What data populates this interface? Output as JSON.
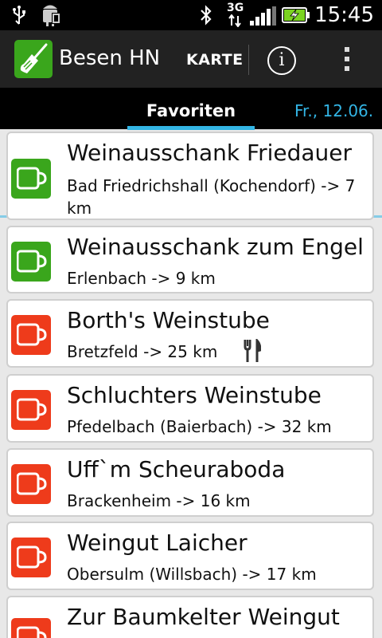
{
  "status_bar": {
    "time": "15:45",
    "network": "3G",
    "icons": [
      "usb-icon",
      "android-debug-icon",
      "bluetooth-icon",
      "signal-icon",
      "battery-charging-icon"
    ]
  },
  "action_bar": {
    "title": "Besen HN",
    "map_label": "KARTE",
    "info_glyph": "i"
  },
  "tabs": {
    "active": "Favoriten",
    "next": "Fr., 12.06."
  },
  "colors": {
    "open": "#3aa61c",
    "closed": "#ee3b1b",
    "accent": "#33b5e5"
  },
  "items": [
    {
      "title": "Weinausschank Friedauer",
      "subtitle": "Bad Friedrichshall (Kochendorf) -> 7 km",
      "status": "open"
    },
    {
      "title": "Weinausschank zum Engel",
      "subtitle": "Erlenbach -> 9 km",
      "status": "open"
    },
    {
      "title": "Borth's Weinstube",
      "subtitle": "Bretzfeld -> 25 km",
      "status": "closed",
      "food": true
    },
    {
      "title": "Schluchters Weinstube",
      "subtitle": "Pfedelbach (Baierbach) -> 32 km",
      "status": "closed"
    },
    {
      "title": "Uff`m Scheuraboda",
      "subtitle": "Brackenheim -> 16 km",
      "status": "closed"
    },
    {
      "title": "Weingut Laicher",
      "subtitle": "Obersulm (Willsbach) -> 17 km",
      "status": "closed"
    },
    {
      "title": "Zur Baumkelter Weingut",
      "subtitle": "",
      "status": "closed"
    }
  ]
}
